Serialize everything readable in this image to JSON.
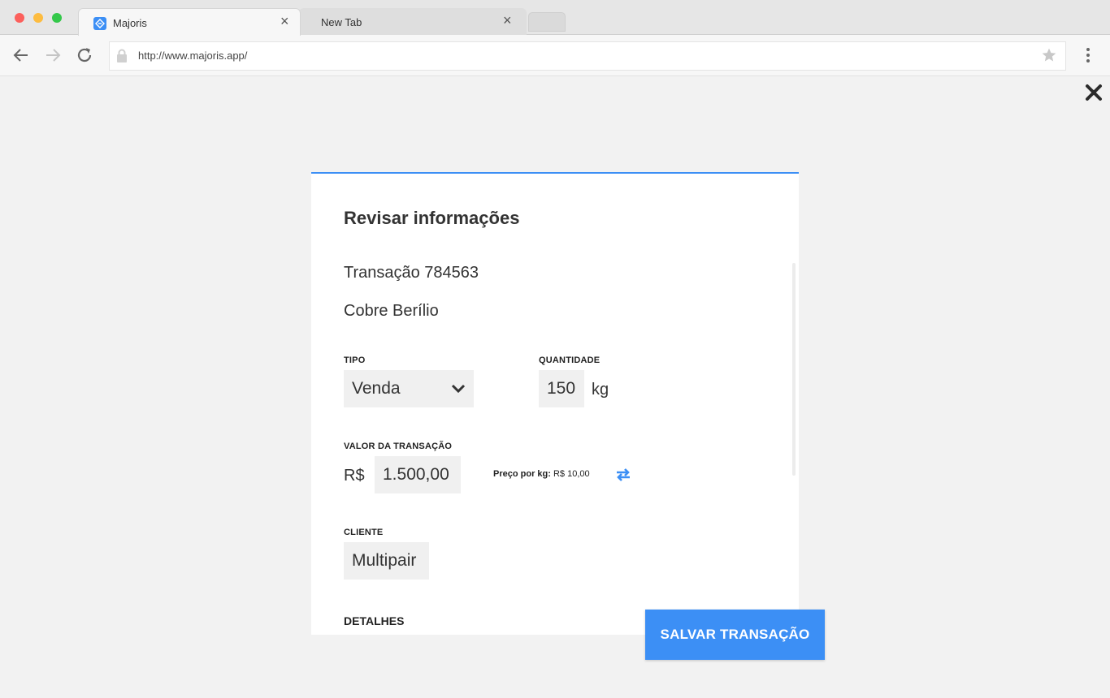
{
  "browser": {
    "tabs": [
      {
        "title": "Majoris",
        "active": true
      },
      {
        "title": "New Tab",
        "active": false
      }
    ],
    "url": "http://www.majoris.app/",
    "accent_color": "#3c8ff5"
  },
  "modal": {
    "title": "Revisar informações",
    "transaction_line": "Transação 784563",
    "product_line": "Cobre Berílio",
    "tipo": {
      "label": "TIPO",
      "value": "Venda"
    },
    "quantidade": {
      "label": "QUANTIDADE",
      "value": "150",
      "unit": "kg"
    },
    "valor": {
      "label": "VALOR DA TRANSAÇÃO",
      "currency": "R$",
      "value": "1.500,00",
      "price_label": "Preço por kg:",
      "price_value": "R$ 10,00"
    },
    "cliente": {
      "label": "CLIENTE",
      "value": "Multipair"
    },
    "detalhes_heading": "DETALHES"
  },
  "actions": {
    "save_label": "SALVAR TRANSAÇÃO"
  }
}
